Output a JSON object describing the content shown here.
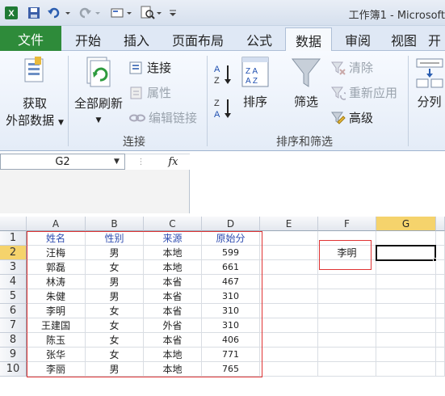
{
  "window": {
    "title": "工作簿1 - Microsoft"
  },
  "tabs": [
    {
      "label": "文件"
    },
    {
      "label": "开始"
    },
    {
      "label": "插入"
    },
    {
      "label": "页面布局"
    },
    {
      "label": "公式"
    },
    {
      "label": "数据"
    },
    {
      "label": "审阅"
    },
    {
      "label": "视图"
    },
    {
      "label": "开"
    }
  ],
  "ribbon": {
    "get_external_line1": "获取",
    "get_external_line2": "外部数据",
    "refresh_all": "全部刷新",
    "connections": "连接",
    "properties": "属性",
    "edit_links": "编辑链接",
    "sort": "排序",
    "filter": "筛选",
    "clear": "清除",
    "reapply": "重新应用",
    "advanced": "高级",
    "split": "分列",
    "group_connections": "连接",
    "group_sort_filter": "排序和筛选"
  },
  "formula_bar": {
    "name_box": "G2",
    "fx": "fx",
    "formula": ""
  },
  "grid": {
    "columns": [
      "A",
      "B",
      "C",
      "D",
      "E",
      "F",
      "G"
    ],
    "rows": [
      "1",
      "2",
      "3",
      "4",
      "5",
      "6",
      "7",
      "8",
      "9",
      "10"
    ],
    "headers": [
      "姓名",
      "性别",
      "来源",
      "原始分"
    ],
    "data": [
      [
        "汪梅",
        "男",
        "本地",
        "599"
      ],
      [
        "郭磊",
        "女",
        "本地",
        "661"
      ],
      [
        "林涛",
        "男",
        "本省",
        "467"
      ],
      [
        "朱健",
        "男",
        "本省",
        "310"
      ],
      [
        "李明",
        "女",
        "本省",
        "310"
      ],
      [
        "王建国",
        "女",
        "外省",
        "310"
      ],
      [
        "陈玉",
        "女",
        "本省",
        "406"
      ],
      [
        "张华",
        "女",
        "本地",
        "771"
      ],
      [
        "李丽",
        "男",
        "本地",
        "765"
      ]
    ],
    "f2_value": "李明",
    "active_cell": "G2"
  },
  "colors": {
    "file_tab": "#2e8b3a",
    "highlight_red": "#e03333",
    "header_text": "#2f4db0",
    "selected_header": "#f5d36c"
  }
}
